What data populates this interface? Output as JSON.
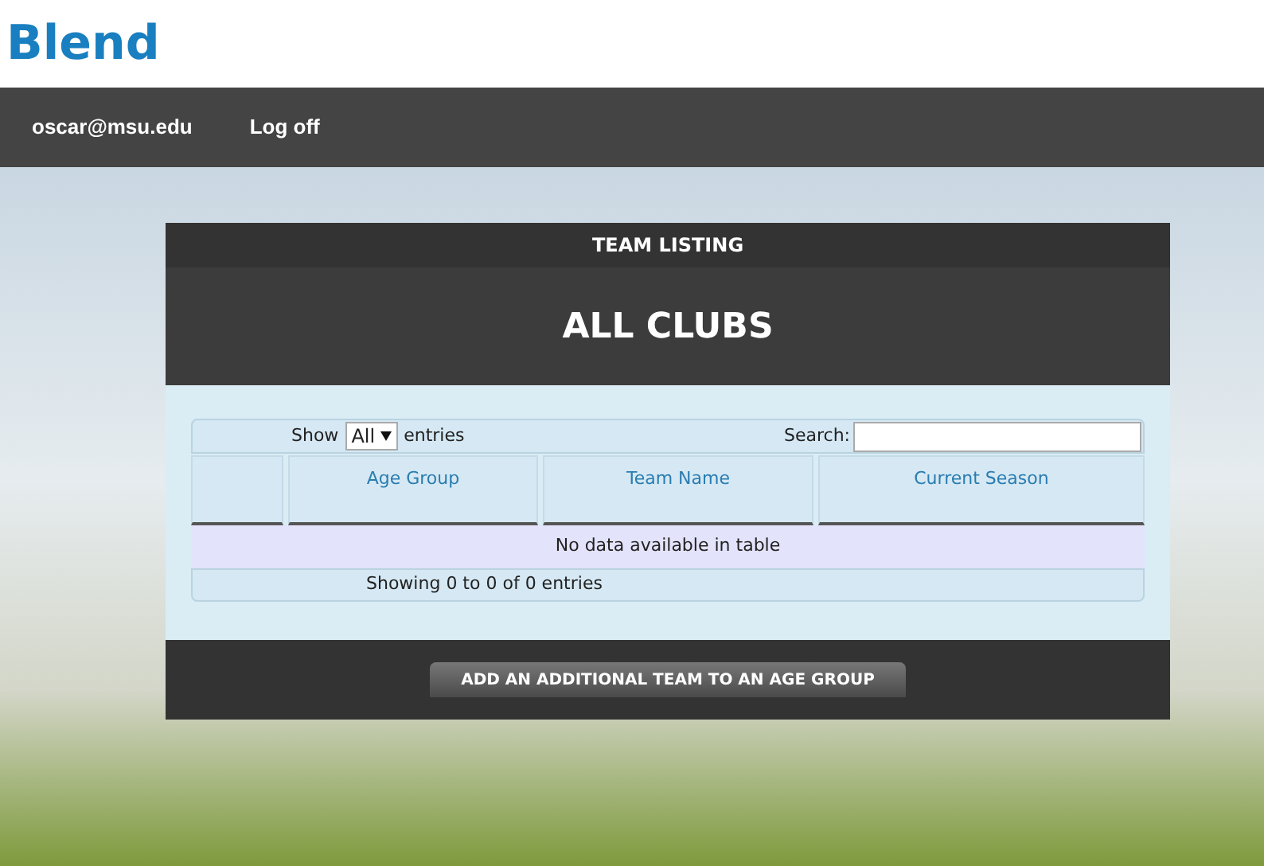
{
  "logo": "Blend",
  "nav": {
    "user": "oscar@msu.edu",
    "logoff": "Log off"
  },
  "panel": {
    "header": "TEAM LISTING",
    "title": "ALL CLUBS",
    "length": {
      "before": "Show",
      "value": "All",
      "after": "entries"
    },
    "search": {
      "label": "Search:"
    },
    "columns": [
      {},
      {
        "label": "Age Group"
      },
      {
        "label": "Team Name"
      },
      {
        "label": "Current Season"
      }
    ],
    "empty": "No data available in table",
    "info": "Showing 0 to 0 of 0 entries",
    "button": "ADD AN ADDITIONAL TEAM TO AN AGE GROUP"
  }
}
